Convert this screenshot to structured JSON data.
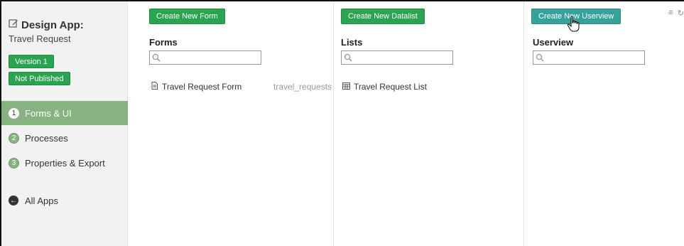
{
  "sidebar": {
    "title": "Design App:",
    "app_name": "Travel Request",
    "version": "Version 1",
    "status": "Not Published",
    "nav": [
      {
        "num": "1",
        "label": "Forms & UI"
      },
      {
        "num": "2",
        "label": "Processes"
      },
      {
        "num": "3",
        "label": "Properties & Export"
      }
    ],
    "back_label": "All Apps"
  },
  "forms": {
    "create_label": "Create New Form",
    "title": "Forms",
    "search_value": "",
    "items": [
      {
        "name": "Travel Request Form",
        "table": "travel_requests"
      }
    ]
  },
  "lists": {
    "create_label": "Create New Datalist",
    "title": "Lists",
    "search_value": "",
    "items": [
      {
        "name": "Travel Request List"
      }
    ]
  },
  "userview": {
    "create_label": "Create New Userview",
    "title": "Userview",
    "search_value": ""
  },
  "icons": {
    "edit": "edit-icon",
    "search": "search-icon",
    "form": "form-icon",
    "list": "list-icon",
    "back": "arrow-left-circle-icon",
    "hand": "hand-pointer-icon"
  },
  "colors": {
    "primary_green": "#2aa44f",
    "active_nav": "#86b37f",
    "teal_button": "#36a39a"
  }
}
